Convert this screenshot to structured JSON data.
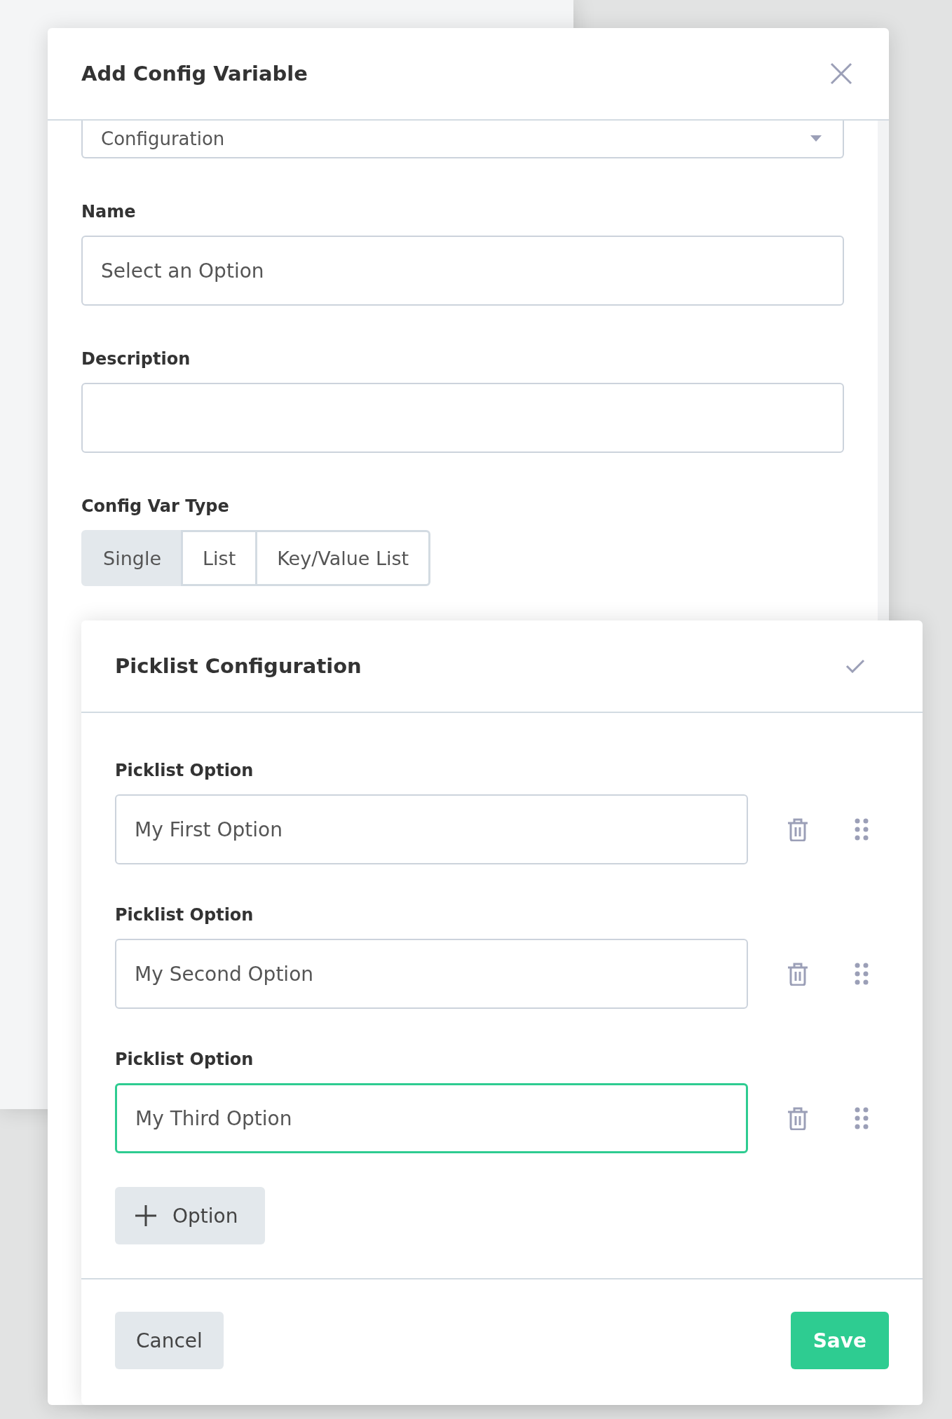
{
  "modal": {
    "title": "Add Config Variable"
  },
  "type_select": {
    "value": "Configuration"
  },
  "name_field": {
    "label": "Name",
    "placeholder": "Select an Option"
  },
  "description_field": {
    "label": "Description"
  },
  "config_var_type": {
    "label": "Config Var Type",
    "options": [
      {
        "label": "Single",
        "selected": true
      },
      {
        "label": "List",
        "selected": false
      },
      {
        "label": "Key/Value List",
        "selected": false
      }
    ]
  },
  "picklist": {
    "title": "Picklist Configuration",
    "options": [
      {
        "label": "Picklist Option",
        "value": "My First Option",
        "focused": false
      },
      {
        "label": "Picklist Option",
        "value": "My Second Option",
        "focused": false
      },
      {
        "label": "Picklist Option",
        "value": "My Third Option",
        "focused": true
      }
    ],
    "add_button": "Option"
  },
  "buttons": {
    "cancel": "Cancel",
    "save": "Save"
  }
}
